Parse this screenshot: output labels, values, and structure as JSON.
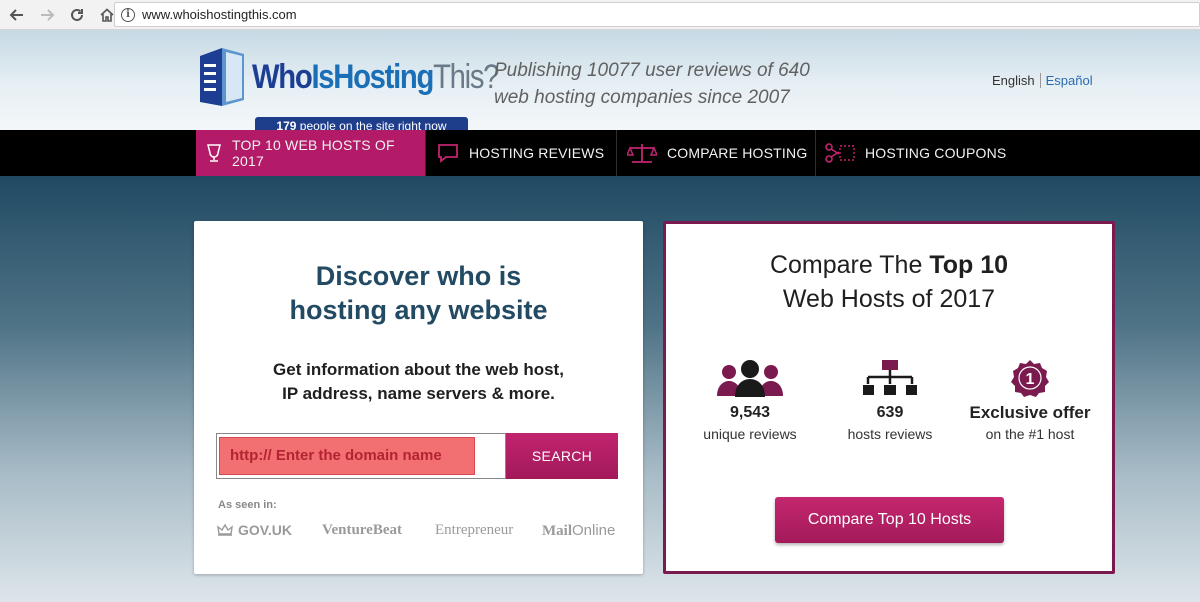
{
  "browser": {
    "url": "www.whoishostingthis.com"
  },
  "header": {
    "logo": {
      "who": "Who",
      "is": "Is",
      "hosting": "Hosting",
      "this": "This?"
    },
    "people_count": "179",
    "people_text": " people on the site right now",
    "tagline_line1": "Publishing 10077 user reviews of 640",
    "tagline_line2": "web hosting companies since 2007",
    "lang_en": "English",
    "lang_es": "Español"
  },
  "nav": {
    "items": [
      {
        "label": "TOP 10 WEB HOSTS OF 2017",
        "icon": "trophy-icon",
        "active": true
      },
      {
        "label": "HOSTING REVIEWS",
        "icon": "speech-bubble-icon"
      },
      {
        "label": "COMPARE HOSTING",
        "icon": "scales-icon"
      },
      {
        "label": "HOSTING COUPONS",
        "icon": "scissors-coupon-icon"
      }
    ]
  },
  "discover": {
    "title_line1": "Discover who is",
    "title_line2": "hosting any website",
    "sub_line1": "Get information about the web host,",
    "sub_line2": "IP address, name servers & more.",
    "search_placeholder": "http:// Enter the domain name",
    "search_button": "SEARCH",
    "seen_in": "As seen in:",
    "press": {
      "gov": "GOV.UK",
      "vb": "VentureBeat",
      "ent": "Entrepreneur",
      "mail_bold": "Mail",
      "mail_rest": "Online"
    }
  },
  "compare": {
    "title_pre": "Compare The ",
    "title_bold": "Top 10",
    "title_line2": "Web Hosts of 2017",
    "stats": [
      {
        "num": "9,543",
        "label": "unique reviews",
        "icon": "users-icon"
      },
      {
        "num": "639",
        "label": "hosts reviews",
        "icon": "hierarchy-icon"
      },
      {
        "num": "Exclusive offer",
        "label": "on the #1 host",
        "icon": "badge-number-one-icon",
        "badge": "1"
      }
    ],
    "button": "Compare Top 10 Hosts"
  },
  "colors": {
    "accent": "#b31a67",
    "brand_blue": "#1c3f94",
    "dark_teal": "#234a63"
  }
}
